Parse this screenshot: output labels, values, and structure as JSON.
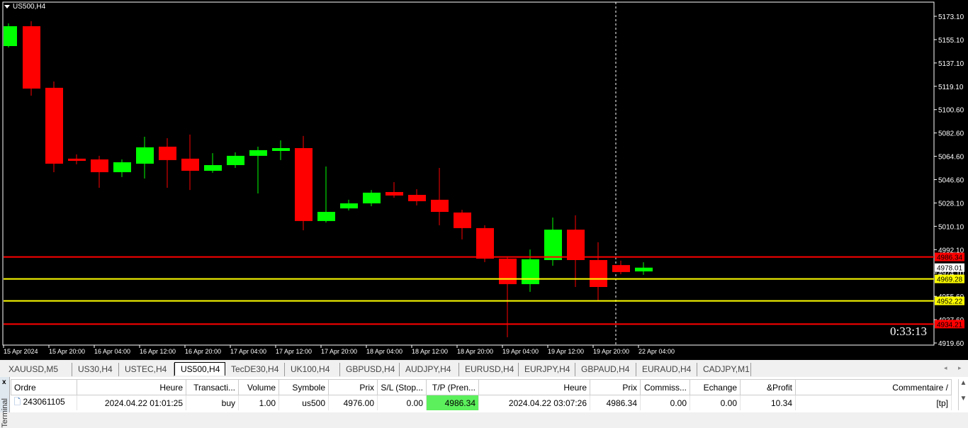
{
  "chart": {
    "symbol": "US500,H4",
    "timer": "0:33:13",
    "bull_color": "#00ff00",
    "bear_color": "#ff0000",
    "price_ticks": [
      "5173.10",
      "5155.10",
      "5137.10",
      "5119.10",
      "5100.60",
      "5082.60",
      "5064.60",
      "5046.60",
      "5028.10",
      "5010.10",
      "4992.10",
      "4974.10",
      "4955.60",
      "4937.60",
      "4919.60"
    ],
    "time_ticks": [
      "15 Apr 2024",
      "15 Apr 20:00",
      "16 Apr 04:00",
      "16 Apr 12:00",
      "16 Apr 20:00",
      "17 Apr 04:00",
      "17 Apr 12:00",
      "17 Apr 20:00",
      "18 Apr 04:00",
      "18 Apr 12:00",
      "18 Apr 20:00",
      "19 Apr 04:00",
      "19 Apr 12:00",
      "19 Apr 20:00",
      "22 Apr 04:00"
    ],
    "current_price": "4978.01",
    "levels": [
      {
        "price": 4986.34,
        "label": "4986.34",
        "color": "#ff0000"
      },
      {
        "price": 4969.28,
        "label": "4969.28",
        "color": "#ffff00"
      },
      {
        "price": 4952.22,
        "label": "4952.22",
        "color": "#ffff00"
      },
      {
        "price": 4934.21,
        "label": "4934.21",
        "color": "#ff0000"
      }
    ],
    "candles": [
      [
        5150.0,
        5167.6,
        5148.9,
        5165.4
      ],
      [
        5165.4,
        5169.3,
        5111.5,
        5117.0
      ],
      [
        5117.6,
        5122.5,
        5052.1,
        5058.7
      ],
      [
        5062.6,
        5065.9,
        5058.2,
        5060.9
      ],
      [
        5062.0,
        5064.8,
        5040.0,
        5052.1
      ],
      [
        5052.1,
        5062.0,
        5048.3,
        5059.8
      ],
      [
        5058.7,
        5079.6,
        5047.2,
        5071.4
      ],
      [
        5071.9,
        5078.5,
        5040.0,
        5061.5
      ],
      [
        5062.6,
        5081.3,
        5038.3,
        5053.2
      ],
      [
        5053.2,
        5066.9,
        5051.6,
        5057.6
      ],
      [
        5057.6,
        5067.5,
        5055.4,
        5064.8
      ],
      [
        5064.8,
        5071.9,
        5035.6,
        5069.2
      ],
      [
        5068.6,
        5076.8,
        5061.5,
        5070.8
      ],
      [
        5070.8,
        5080.2,
        5007.0,
        5014.2
      ],
      [
        5014.2,
        5056.5,
        5013.0,
        5021.3
      ],
      [
        5024.0,
        5030.7,
        5022.4,
        5027.9
      ],
      [
        5027.9,
        5038.3,
        5025.7,
        5036.2
      ],
      [
        5036.7,
        5044.4,
        5032.3,
        5034.0
      ],
      [
        5034.5,
        5038.9,
        5026.3,
        5029.6
      ],
      [
        5030.7,
        5055.4,
        5010.9,
        5021.3
      ],
      [
        5020.8,
        5022.9,
        4999.9,
        5008.7
      ],
      [
        5008.7,
        5010.9,
        4982.3,
        4985.0
      ],
      [
        4985.0,
        4986.1,
        4924.0,
        4965.2
      ],
      [
        4965.2,
        4992.1,
        4959.2,
        4984.5
      ],
      [
        4983.9,
        5016.9,
        4979.5,
        5007.5
      ],
      [
        5007.5,
        5018.6,
        4963.0,
        4983.9
      ],
      [
        4983.9,
        4997.7,
        4952.6,
        4963.0
      ],
      [
        4980.0,
        4983.4,
        4972.9,
        4974.6
      ],
      [
        4975.1,
        4982.2,
        4972.4,
        4978.0
      ]
    ]
  },
  "tabs": [
    "XAUUSD,M5",
    "US30,H4",
    "USTEC,H4",
    "US500,H4",
    "TecDE30,H4",
    "UK100,H4",
    "GBPUSD,H4",
    "AUDJPY,H4",
    "EURUSD,H4",
    "EURJPY,H4",
    "GBPAUD,H4",
    "EURAUD,H4",
    "CADJPY,M1"
  ],
  "active_tab": "US500,H4",
  "terminal": {
    "side_label": "Terminal",
    "close": "x",
    "columns": [
      "Ordre",
      "Heure",
      "Transacti...",
      "Volume",
      "Symbole",
      "Prix",
      "S/L (Stop...",
      "T/P (Pren...",
      "Heure",
      "Prix",
      "Commiss...",
      "Echange",
      "&Profit",
      "Commentaire  /"
    ],
    "rows": [
      [
        "243061105",
        "2024.04.22 01:01:25",
        "buy",
        "1.00",
        "us500",
        "4976.00",
        "0.00",
        "4986.34",
        "2024.04.22 03:07:26",
        "4986.34",
        "0.00",
        "0.00",
        "10.34",
        "[tp]"
      ]
    ]
  }
}
